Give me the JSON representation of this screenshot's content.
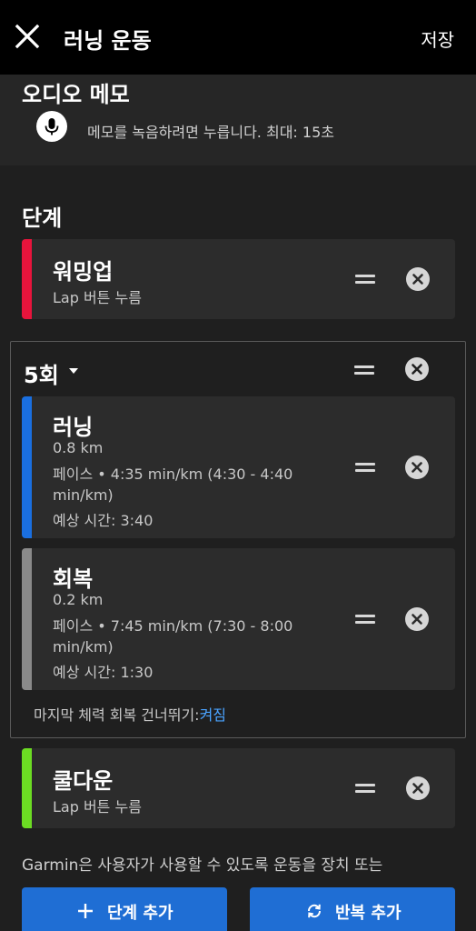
{
  "appbar": {
    "title": "러닝 운동",
    "save_label": "저장"
  },
  "audio_memo": {
    "heading": "오디오 메모",
    "hint": "메모를 녹음하려면 누릅니다. 최대: 15초"
  },
  "steps_heading": "단계",
  "warmup": {
    "title": "워밍업",
    "subtitle": "Lap 버튼 누름",
    "color": "#e8143c"
  },
  "repeat": {
    "label": "5회",
    "run": {
      "title": "러닝",
      "distance": "0.8 km",
      "pace": "페이스 • 4:35 min/km (4:30 - 4:40 min/km)",
      "eta": "예상 시간: 3:40",
      "color": "#1a6fe0"
    },
    "recovery": {
      "title": "회복",
      "distance": "0.2 km",
      "pace": "페이스 • 7:45 min/km (7:30 - 8:00 min/km)",
      "eta": "예상 시간: 1:30",
      "color": "#8a8a8a"
    },
    "skip_label": "마지막 체력 회복 건너뛰기:",
    "skip_value": "켜짐"
  },
  "cooldown": {
    "title": "쿨다운",
    "subtitle": "Lap 버튼 누름",
    "color": "#6cdc23"
  },
  "footer_note": "Garmin은 사용자가 사용할 수 있도록 운동을 장치 또는",
  "buttons": {
    "add_step": "단계 추가",
    "add_repeat": "반복 추가"
  },
  "colors": {
    "accent": "#1f6ed4",
    "link": "#4aa3ff"
  }
}
